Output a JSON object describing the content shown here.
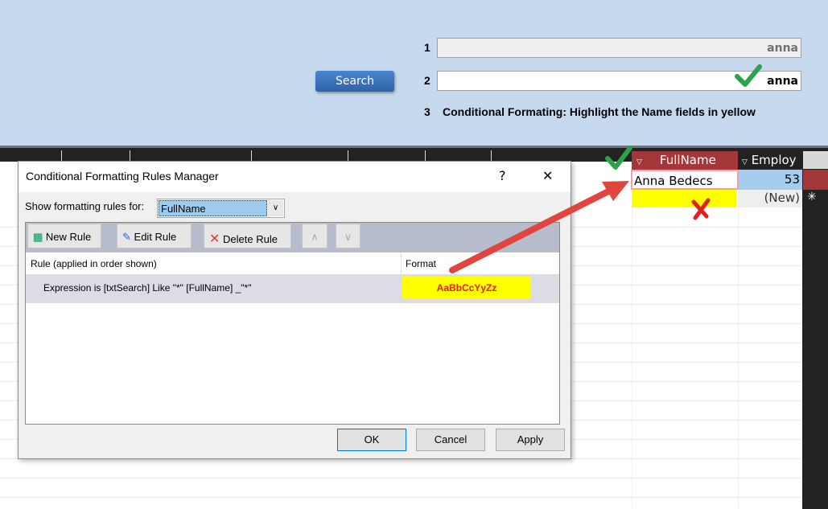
{
  "form": {
    "search_label": "Search",
    "row1_num": "1",
    "row1_value": "anna",
    "row2_num": "2",
    "row2_value": "anna",
    "row3_num": "3",
    "row3_text": "Conditional Formating: Highlight the Name fields in yellow"
  },
  "datasheet": {
    "columns": [
      "FullName",
      "Employ"
    ],
    "rows": [
      {
        "fullname": "Anna Bedecs",
        "employ": "53"
      },
      {
        "fullname": "",
        "employ": "(New)"
      }
    ],
    "new_row_marker": "✳"
  },
  "dialog": {
    "title": "Conditional Formatting Rules Manager",
    "help": "?",
    "close": "✕",
    "show_label": "Show formatting rules for:",
    "show_value": "FullName",
    "toolbar": {
      "new_rule": "New Rule",
      "edit_rule": "Edit Rule",
      "delete_rule": "Delete Rule"
    },
    "list": {
      "col_rule": "Rule (applied in order shown)",
      "col_format": "Format",
      "rules": [
        {
          "rule": "Expression is [txtSearch] Like \"*\"  [FullName] _\"*\"",
          "format_preview": "AaBbCcYyZz"
        }
      ]
    },
    "buttons": {
      "ok": "OK",
      "cancel": "Cancel",
      "apply": "Apply"
    }
  },
  "colors": {
    "highlight": "#ffff00",
    "header": "#a4373a",
    "arrow": "#e0453f",
    "check": "#2aa34a"
  }
}
